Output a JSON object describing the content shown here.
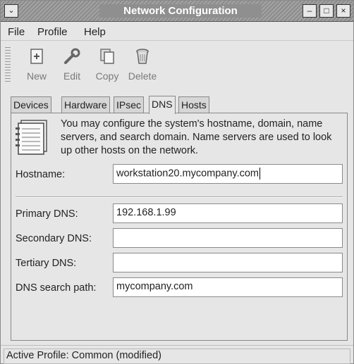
{
  "window": {
    "title": "Network Configuration",
    "controls": {
      "menu": "⌄",
      "minimize": "–",
      "maximize": "□",
      "close": "×"
    }
  },
  "menubar": {
    "file": "File",
    "profile": "Profile",
    "help": "Help"
  },
  "toolbar": {
    "new_label": "New",
    "edit_label": "Edit",
    "copy_label": "Copy",
    "delete_label": "Delete"
  },
  "tabs": [
    {
      "label": "Devices",
      "active": false
    },
    {
      "label": "Hardware",
      "active": false
    },
    {
      "label": "IPsec",
      "active": false
    },
    {
      "label": "DNS",
      "active": true
    },
    {
      "label": "Hosts",
      "active": false
    }
  ],
  "dns": {
    "info": "You may configure the system's hostname, domain, name servers, and search domain. Name servers are used to look up other hosts on the network.",
    "hostname_label": "Hostname:",
    "hostname_value": "workstation20.mycompany.com",
    "primary_label": "Primary DNS:",
    "primary_value": "192.168.1.99",
    "secondary_label": "Secondary DNS:",
    "secondary_value": "",
    "tertiary_label": "Tertiary DNS:",
    "tertiary_value": "",
    "search_label": "DNS search path:",
    "search_value": "mycompany.com"
  },
  "status": {
    "text": "Active Profile: Common (modified)"
  },
  "icons": {
    "dns": "address-book-icon",
    "new": "new-device-icon",
    "edit": "wrench-icon",
    "copy": "copy-icon",
    "delete": "trash-icon"
  }
}
